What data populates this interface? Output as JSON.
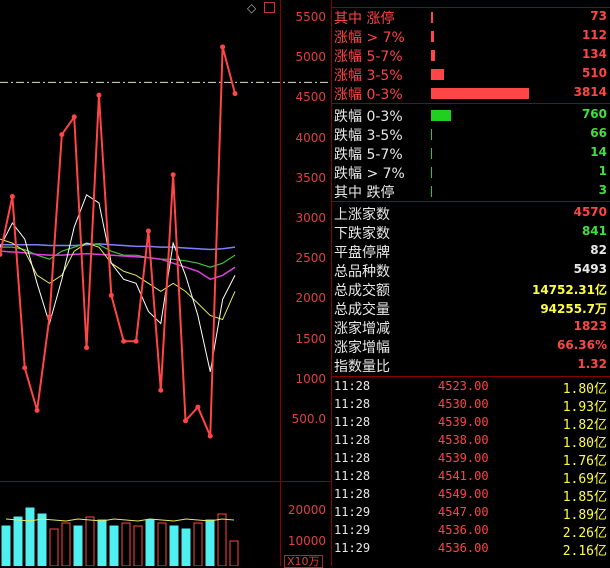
{
  "chart": {
    "y_ticks": [
      "5500",
      "5000",
      "4500",
      "4000",
      "3500",
      "3000",
      "2500",
      "2000",
      "1500",
      "1000",
      "500.0"
    ],
    "vol_ticks": [
      "20000",
      "10000"
    ],
    "vol_unit": "X10万",
    "price_series": [
      2560,
      3280,
      1150,
      620,
      1780,
      4050,
      4270,
      1400,
      4540,
      2050,
      1480,
      1480,
      2850,
      870,
      3550,
      490,
      660,
      300,
      5140,
      4560
    ],
    "white_series": [
      2650,
      2950,
      2750,
      2200,
      1700,
      2250,
      2900,
      3300,
      3200,
      2450,
      2250,
      2200,
      1850,
      1700,
      2700,
      2300,
      1800,
      1100,
      2000,
      2300
    ],
    "yellow_series": [
      2750,
      2700,
      2600,
      2300,
      2200,
      2300,
      2600,
      2700,
      2650,
      2450,
      2350,
      2300,
      2200,
      2100,
      2200,
      2100,
      1950,
      1800,
      1750,
      2100
    ],
    "green_series": [
      2650,
      2650,
      2620,
      2550,
      2500,
      2600,
      2650,
      2700,
      2680,
      2600,
      2550,
      2550,
      2520,
      2500,
      2500,
      2480,
      2450,
      2400,
      2450,
      2550
    ],
    "magenta_series": [
      2600,
      2590,
      2580,
      2560,
      2550,
      2550,
      2560,
      2570,
      2560,
      2550,
      2540,
      2530,
      2520,
      2500,
      2450,
      2400,
      2350,
      2250,
      2300,
      2400
    ],
    "blue_series": [
      2680,
      2680,
      2680,
      2680,
      2670,
      2670,
      2670,
      2680,
      2690,
      2680,
      2670,
      2660,
      2660,
      2650,
      2650,
      2640,
      2630,
      2620,
      2630,
      2650
    ],
    "volume_bars": [
      15000,
      18000,
      21000,
      19000,
      14000,
      16000,
      15000,
      18000,
      17000,
      15000,
      16000,
      15000,
      17000,
      16000,
      15000,
      14000,
      16000,
      17000,
      19000,
      10000
    ],
    "ref_level": 4700
  },
  "stats": {
    "rows_up": [
      {
        "label": "其中 涨停",
        "value": "73",
        "bar": 2
      },
      {
        "label": "涨幅 > 7%",
        "value": "112",
        "bar": 3
      },
      {
        "label": "涨幅 5-7%",
        "value": "134",
        "bar": 4
      },
      {
        "label": "涨幅 3-5%",
        "value": "510",
        "bar": 13
      },
      {
        "label": "涨幅 0-3%",
        "value": "3814",
        "bar": 98
      }
    ],
    "rows_down": [
      {
        "label": "跌幅 0-3%",
        "value": "760",
        "bar": 20
      },
      {
        "label": "跌幅 3-5%",
        "value": "66",
        "bar": 1
      },
      {
        "label": "跌幅 5-7%",
        "value": "14",
        "bar": 1
      },
      {
        "label": "跌幅 > 7%",
        "value": "1",
        "bar": 1
      },
      {
        "label": "其中 跌停",
        "value": "3",
        "bar": 1
      }
    ],
    "summary": [
      {
        "label": "上涨家数",
        "value": "4570",
        "color": "#ff4545"
      },
      {
        "label": "下跌家数",
        "value": "841",
        "color": "#40e040"
      },
      {
        "label": "平盘停牌",
        "value": "82",
        "color": "#e8e8e8"
      },
      {
        "label": "总品种数",
        "value": "5493",
        "color": "#e8e8e8"
      },
      {
        "label": "总成交额",
        "value": "14752.31亿",
        "color": "#ffff40"
      },
      {
        "label": "总成交量",
        "value": "94255.7万",
        "color": "#ffff40"
      },
      {
        "label": "涨家增减",
        "value": "1823",
        "color": "#ff4545"
      },
      {
        "label": "涨家增幅",
        "value": "66.36%",
        "color": "#ff4545"
      },
      {
        "label": "指数量比",
        "value": "1.32",
        "color": "#ff4545"
      }
    ]
  },
  "ticks": [
    {
      "time": "11:28",
      "price": "4523.00",
      "vol": "1.80亿"
    },
    {
      "time": "11:28",
      "price": "4530.00",
      "vol": "1.93亿"
    },
    {
      "time": "11:28",
      "price": "4539.00",
      "vol": "1.82亿"
    },
    {
      "time": "11:28",
      "price": "4538.00",
      "vol": "1.80亿"
    },
    {
      "time": "11:28",
      "price": "4539.00",
      "vol": "1.76亿"
    },
    {
      "time": "11:28",
      "price": "4541.00",
      "vol": "1.69亿"
    },
    {
      "time": "11:28",
      "price": "4549.00",
      "vol": "1.85亿"
    },
    {
      "time": "11:29",
      "price": "4547.00",
      "vol": "1.89亿"
    },
    {
      "time": "11:29",
      "price": "4536.00",
      "vol": "2.26亿"
    },
    {
      "time": "11:29",
      "price": "4536.00",
      "vol": "2.16亿"
    }
  ]
}
